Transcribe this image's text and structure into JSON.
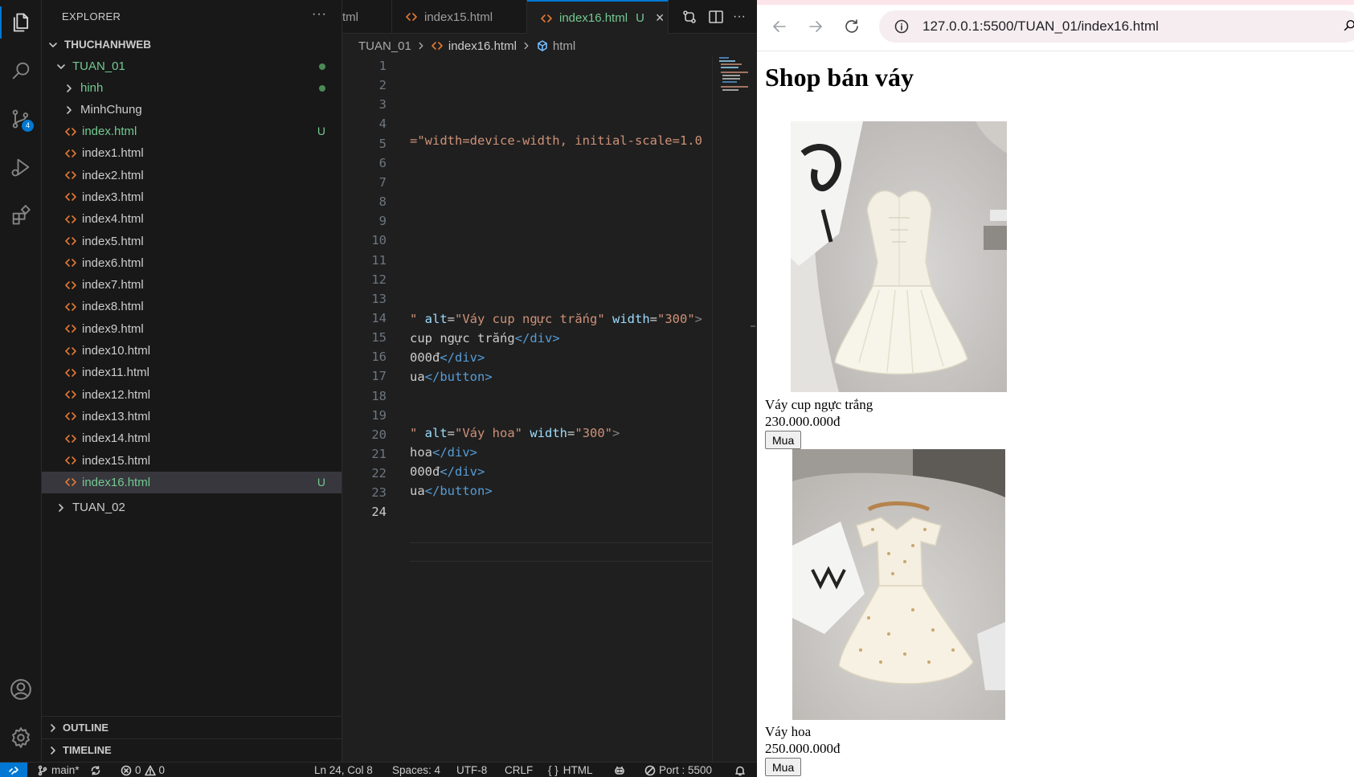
{
  "activity_bar": {
    "source_control_badge": "4"
  },
  "explorer": {
    "title": "EXPLORER",
    "more": "···",
    "workspace": "THUCHANHWEB",
    "folder": "TUAN_01",
    "subfolders": [
      "hinh",
      "MinhChung"
    ],
    "files": [
      {
        "name": "index.html",
        "badge": "U"
      },
      {
        "name": "index1.html",
        "badge": ""
      },
      {
        "name": "index2.html",
        "badge": ""
      },
      {
        "name": "index3.html",
        "badge": ""
      },
      {
        "name": "index4.html",
        "badge": ""
      },
      {
        "name": "index5.html",
        "badge": ""
      },
      {
        "name": "index6.html",
        "badge": ""
      },
      {
        "name": "index7.html",
        "badge": ""
      },
      {
        "name": "index8.html",
        "badge": ""
      },
      {
        "name": "index9.html",
        "badge": ""
      },
      {
        "name": "index10.html",
        "badge": ""
      },
      {
        "name": "index11.html",
        "badge": ""
      },
      {
        "name": "index12.html",
        "badge": ""
      },
      {
        "name": "index13.html",
        "badge": ""
      },
      {
        "name": "index14.html",
        "badge": ""
      },
      {
        "name": "index15.html",
        "badge": ""
      },
      {
        "name": "index16.html",
        "badge": "U"
      }
    ],
    "other_folder": "TUAN_02",
    "outline": "OUTLINE",
    "timeline": "TIMELINE"
  },
  "editor": {
    "tabs": [
      {
        "label": "tml",
        "modified": ""
      },
      {
        "label": "index15.html",
        "modified": ""
      },
      {
        "label": "index16.html",
        "modified": "U"
      }
    ],
    "breadcrumb": {
      "folder": "TUAN_01",
      "file": "index16.html",
      "symbol": "html"
    },
    "line_numbers": [
      "1",
      "2",
      "3",
      "4",
      "5",
      "6",
      "7",
      "8",
      "9",
      "10",
      "11",
      "12",
      "13",
      "14",
      "15",
      "16",
      "17",
      "18",
      "19",
      "20",
      "21",
      "22",
      "23",
      "24"
    ],
    "current_line": "24",
    "code": {
      "l5_str": "=\"width=device-width, initial-scale=1.0",
      "l11_str1": "\"",
      "l11_attr1": " alt",
      "l11_eq1": "=",
      "l11_str2": "\"Váy cup ngực trắng\"",
      "l11_attr2": " width",
      "l11_eq2": "=",
      "l11_str3": "\"300\"",
      "l11_end": ">",
      "l12_text": "cup ngực trắng",
      "l12_tag": "</div>",
      "l13_text": "000đ",
      "l13_tag": "</div>",
      "l14_text": "ua",
      "l14_tag": "</button>",
      "l17_str1": "\"",
      "l17_attr1": " alt",
      "l17_eq1": "=",
      "l17_str2": "\"Váy hoa\"",
      "l17_attr2": " width",
      "l17_eq2": "=",
      "l17_str3": "\"300\"",
      "l17_end": ">",
      "l18_text": "hoa",
      "l18_tag": "</div>",
      "l19_text": "000đ",
      "l19_tag": "</div>",
      "l20_text": "ua",
      "l20_tag": "</button>"
    }
  },
  "status_bar": {
    "branch": "main*",
    "errors": "0",
    "warnings": "0",
    "position": "Ln 24, Col 8",
    "spaces": "Spaces: 4",
    "encoding": "UTF-8",
    "eol": "CRLF",
    "language": "HTML",
    "port": "Port : 5500"
  },
  "browser": {
    "url": "127.0.0.1:5500/TUAN_01/index16.html",
    "page": {
      "heading": "Shop bán váy",
      "products": [
        {
          "name": "Váy cup ngực trắng",
          "price": "230.000.000đ",
          "button": "Mua"
        },
        {
          "name": "Váy hoa",
          "price": "250.000.000đ",
          "button": "Mua"
        }
      ]
    }
  },
  "colors": {
    "accent": "#0078d4",
    "untracked": "#73c991",
    "html_icon": "#e37933"
  }
}
